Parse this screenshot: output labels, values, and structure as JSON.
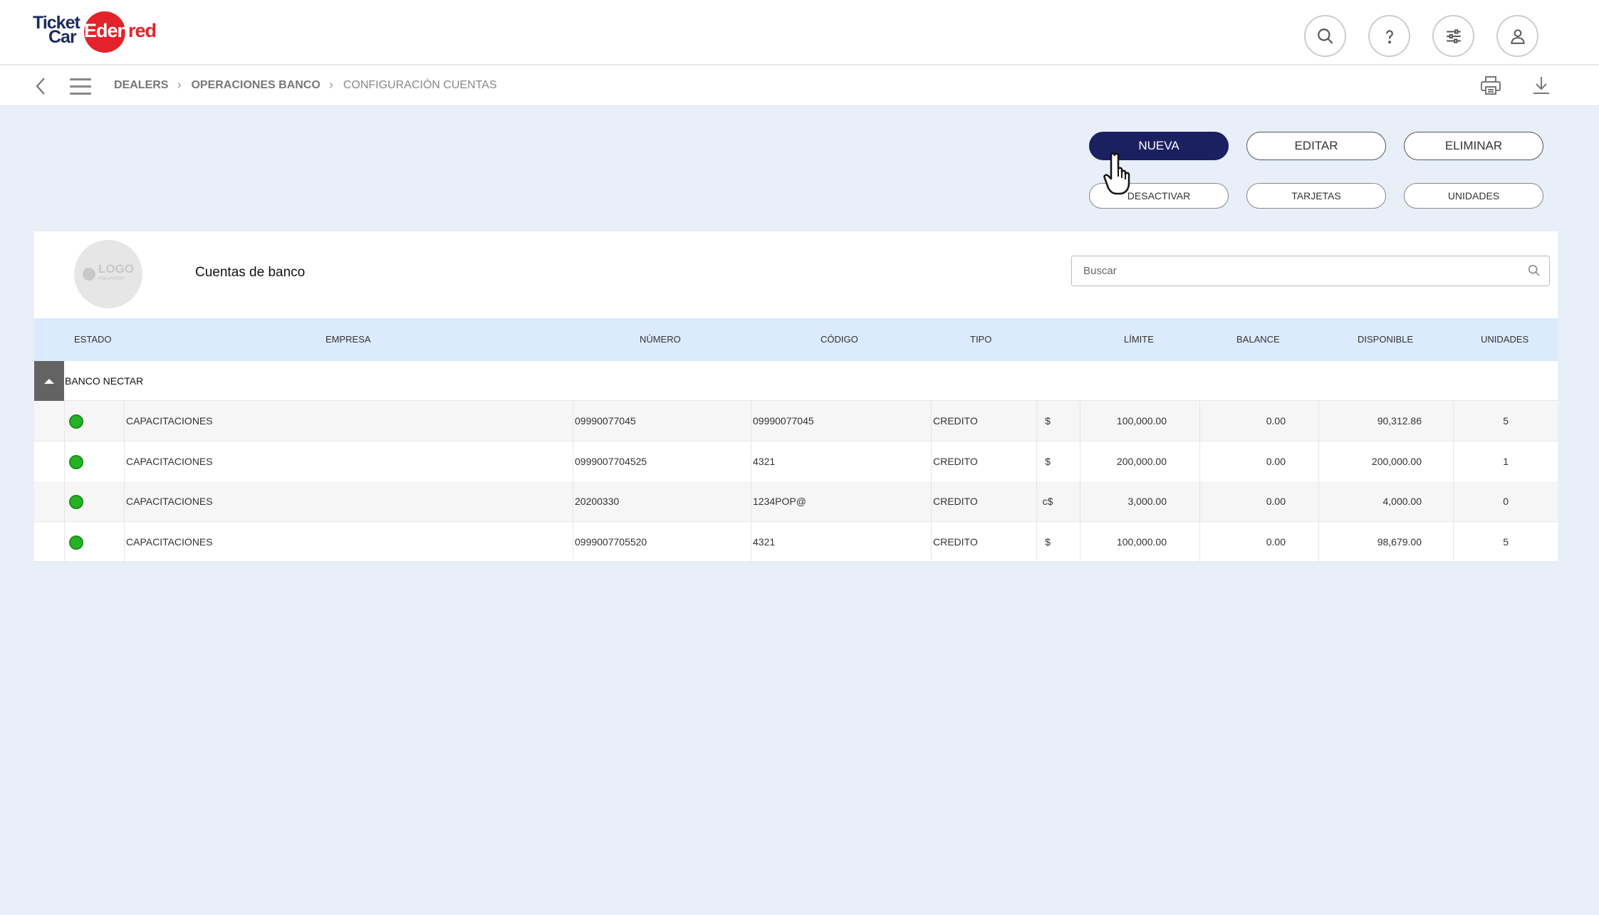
{
  "brand": {
    "ticket": "Ticket",
    "car": "Car",
    "edenred_a": "Eden",
    "edenred_b": "red"
  },
  "header_icons": [
    "search-icon",
    "help-icon",
    "filter-sliders-icon",
    "user-icon"
  ],
  "breadcrumb": {
    "items": [
      "DEALERS",
      "OPERACIONES BANCO"
    ],
    "current": "CONFIGURACIÓN CUENTAS"
  },
  "actions": {
    "nueva": "NUEVA",
    "editar": "EDITAR",
    "eliminar": "ELIMINAR",
    "desactivar": "DESACTIVAR",
    "tarjetas": "TARJETAS",
    "unidades": "UNIDADES"
  },
  "card": {
    "logo_text": "LOGO",
    "logo_sub": "Placeholder",
    "title": "Cuentas de banco",
    "search_placeholder": "Buscar"
  },
  "table": {
    "headers": {
      "estado": "ESTADO",
      "empresa": "EMPRESA",
      "numero": "NÚMERO",
      "codigo": "CÓDIGO",
      "tipo": "TIPO",
      "limite": "LÍMITE",
      "balance": "BALANCE",
      "disponible": "DISPONIBLE",
      "unidades": "UNIDADES"
    },
    "group": "BANCO NECTAR",
    "rows": [
      {
        "status": "active",
        "empresa": "CAPACITACIONES",
        "numero": "09990077045",
        "codigo": "09990077045",
        "tipo": "CREDITO",
        "moneda": "$",
        "limite": "100,000.00",
        "balance": "0.00",
        "disponible": "90,312.86",
        "unidades": "5"
      },
      {
        "status": "active",
        "empresa": "CAPACITACIONES",
        "numero": "0999007704525",
        "codigo": "4321",
        "tipo": "CREDITO",
        "moneda": "$",
        "limite": "200,000.00",
        "balance": "0.00",
        "disponible": "200,000.00",
        "unidades": "1"
      },
      {
        "status": "active",
        "empresa": "CAPACITACIONES",
        "numero": "20200330",
        "codigo": "1234POP@",
        "tipo": "CREDITO",
        "moneda": "c$",
        "limite": "3,000.00",
        "balance": "0.00",
        "disponible": "4,000.00",
        "unidades": "0"
      },
      {
        "status": "active",
        "empresa": "CAPACITACIONES",
        "numero": "0999007705520",
        "codigo": "4321",
        "tipo": "CREDITO",
        "moneda": "$",
        "limite": "100,000.00",
        "balance": "0.00",
        "disponible": "98,679.00",
        "unidades": "5"
      }
    ]
  },
  "colors": {
    "primary": "#1b2060",
    "background": "#e8eff8",
    "table_header": "#dbeafc",
    "status_active": "#25b325",
    "brand_red": "#e3222b"
  }
}
